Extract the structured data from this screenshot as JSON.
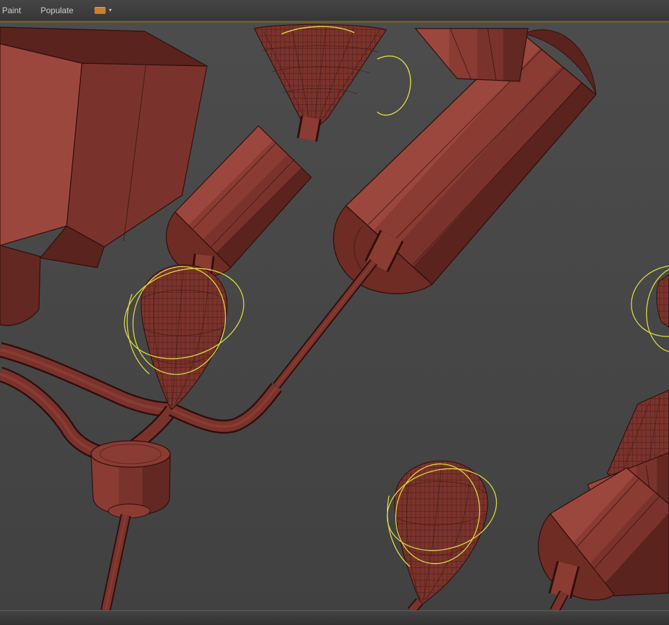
{
  "toolbar": {
    "tabs": [
      {
        "label": "Paint"
      },
      {
        "label": "Populate"
      }
    ],
    "flyout": {
      "caret": "▾"
    }
  },
  "colors": {
    "toolbar-bg": "#373737",
    "toolbar-grad-top": "#454545",
    "toolbar-text": "#cfcfcf",
    "accent-orange": "#c9812e",
    "active-border": "#6e5f28",
    "viewport-bg": "#4c4c4c",
    "viewport-bg-deep": "#414141",
    "obj-light": "#9c473d",
    "obj-mid": "#8a3b32",
    "obj-base": "#7a332c",
    "obj-dark": "#632822",
    "obj-deep": "#5a231e",
    "obj-cap": "#6e2c25",
    "edge": "#2f0f0b",
    "helper-yellow": "#dcdc3e",
    "bar-bg": "#323232",
    "bar-grad-top": "#434343"
  },
  "scene": {
    "objects": [
      "chamfered-box",
      "wireframe-cone",
      "tapered-frustum",
      "large-cylinder",
      "barrel-cylinder",
      "muscle-teardrop",
      "pipe-network",
      "piston-cylinder",
      "bottom-teardrop",
      "right-limb-assembly",
      "selection-circle-helpers"
    ]
  }
}
